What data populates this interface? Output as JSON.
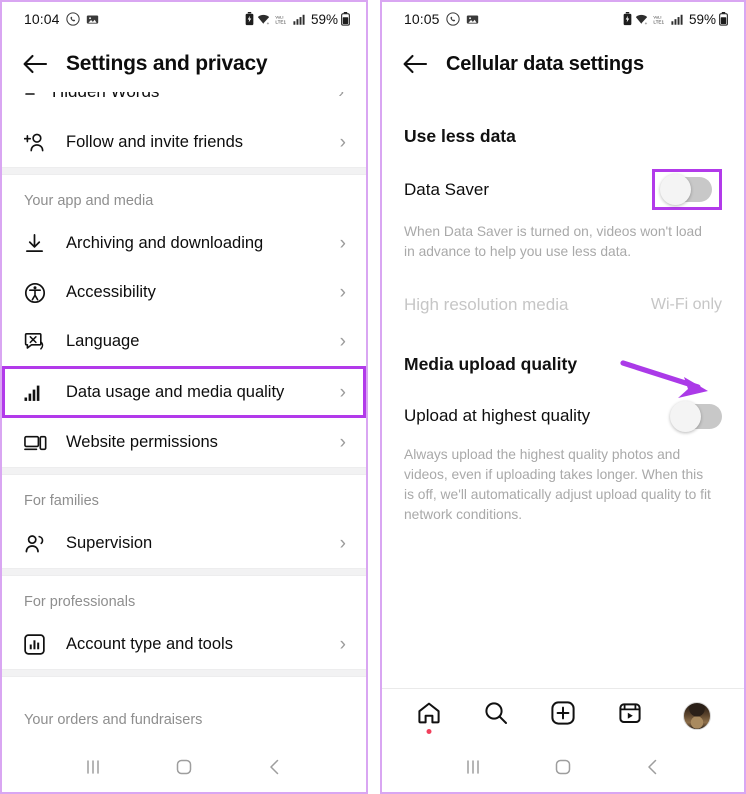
{
  "left_phone": {
    "status_bar": {
      "time": "10:04",
      "left_icons": [
        "whatsapp-icon",
        "photo-icon"
      ],
      "right_icons": [
        "battery-saver-icon",
        "wifi-icon",
        "volte-icon",
        "signal-bars-icon"
      ],
      "battery_percent": "59%"
    },
    "header": {
      "back": "back-arrow",
      "title": "Settings and privacy"
    },
    "partial_top_row": {
      "label": "Hidden Words"
    },
    "items": [
      {
        "label": "Follow and invite friends",
        "icon": "add-person-icon",
        "chevron": "›",
        "highlighted": false
      },
      {
        "label": "Archiving and downloading",
        "icon": "download-icon",
        "chevron": "›",
        "highlighted": false
      },
      {
        "label": "Accessibility",
        "icon": "accessibility-icon",
        "chevron": "›",
        "highlighted": false
      },
      {
        "label": "Language",
        "icon": "language-icon",
        "chevron": "›",
        "highlighted": false
      },
      {
        "label": "Data usage and media quality",
        "icon": "signal-bars-icon",
        "chevron": "›",
        "highlighted": true
      },
      {
        "label": "Website permissions",
        "icon": "website-icon",
        "chevron": "›",
        "highlighted": false
      },
      {
        "label": "Supervision",
        "icon": "people-icon",
        "chevron": "›",
        "highlighted": false
      },
      {
        "label": "Account type and tools",
        "icon": "account-tools-icon",
        "chevron": "›",
        "highlighted": false
      }
    ],
    "sections": {
      "app_and_media": "Your app and media",
      "for_families": "For families",
      "for_professionals": "For professionals",
      "orders_and_fundraisers": "Your orders and fundraisers"
    }
  },
  "right_phone": {
    "status_bar": {
      "time": "10:05",
      "left_icons": [
        "whatsapp-icon",
        "photo-icon"
      ],
      "right_icons": [
        "battery-saver-icon",
        "wifi-icon",
        "volte-icon",
        "signal-bars-icon"
      ],
      "battery_percent": "59%"
    },
    "header": {
      "back": "back-arrow",
      "title": "Cellular data settings"
    },
    "use_less_data": {
      "section_title": "Use less data",
      "data_saver_label": "Data Saver",
      "data_saver_state": "off",
      "data_saver_help": "When Data Saver is turned on, videos won't load in advance to help you use less data.",
      "high_res_label": "High resolution media",
      "high_res_value": "Wi-Fi only"
    },
    "media_upload_quality": {
      "section_title": "Media upload quality",
      "upload_label": "Upload at highest quality",
      "upload_state": "off",
      "upload_help": "Always upload the highest quality photos and videos, even if uploading takes longer. When this is off, we'll automatically adjust upload quality to fit network conditions."
    },
    "bottom_nav": [
      {
        "name": "home-icon",
        "badge": true
      },
      {
        "name": "search-icon",
        "badge": false
      },
      {
        "name": "create-icon",
        "badge": false
      },
      {
        "name": "reels-icon",
        "badge": false
      },
      {
        "name": "profile-avatar",
        "badge": false
      }
    ]
  },
  "system_nav": {
    "recents": "recents-icon",
    "home": "home-square-icon",
    "back": "back-chevron-icon"
  },
  "annotations": {
    "highlight_color": "#b23aea",
    "arrow_color": "#ab3ae8",
    "frame_color": "#d9a6f2"
  }
}
